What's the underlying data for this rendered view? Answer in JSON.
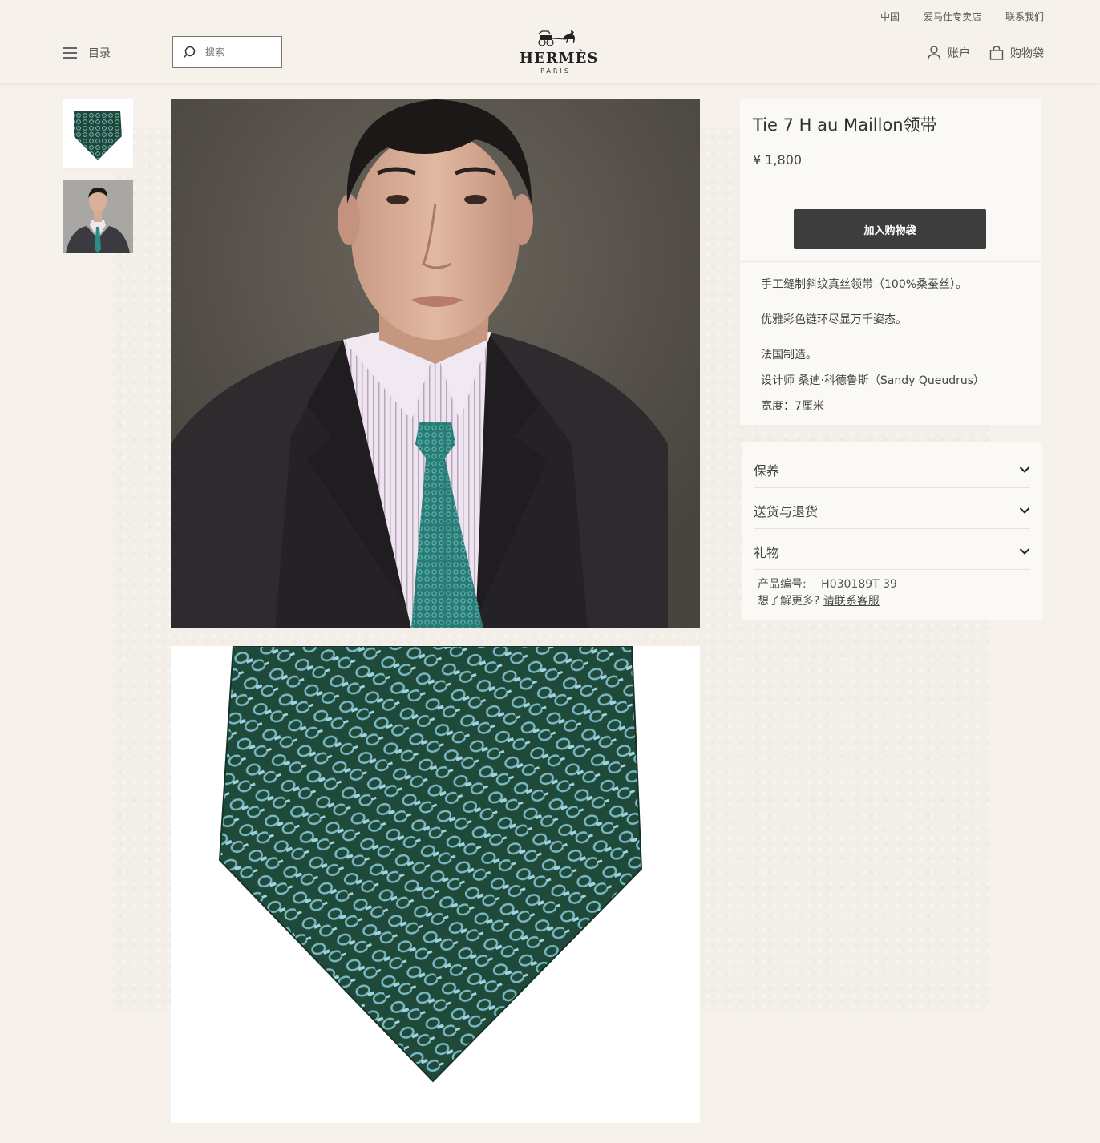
{
  "header": {
    "top_links": [
      "中国",
      "爱马仕专卖店",
      "联系我们"
    ],
    "menu_label": "目录",
    "search_placeholder": "搜索",
    "logo": {
      "word": "HERMÈS",
      "sub": "PARIS"
    },
    "account_label": "账户",
    "bag_label": "购物袋"
  },
  "product": {
    "title": "Tie 7 H au Maillon领带",
    "price": "¥ 1,800",
    "add_to_bag": "加入购物袋",
    "description": [
      "手工缝制斜纹真丝领带（100%桑蚕丝）。",
      "优雅彩色链环尽显万千姿态。",
      "法国制造。",
      "设计师 桑迪·科德鲁斯（Sandy Queudrus）",
      "宽度：7厘米"
    ],
    "accordion": [
      "保养",
      "送货与退货",
      "礼物"
    ],
    "sku_label": "产品编号:",
    "sku_value": "H030189T 39",
    "more_label": "想了解更多?",
    "contact_link": "请联系客服"
  },
  "colors": {
    "background": "#f6f1eb",
    "button": "#3d3d3d",
    "tie_green": "#1f4a3a",
    "tie_pattern": "#79b8c4"
  }
}
